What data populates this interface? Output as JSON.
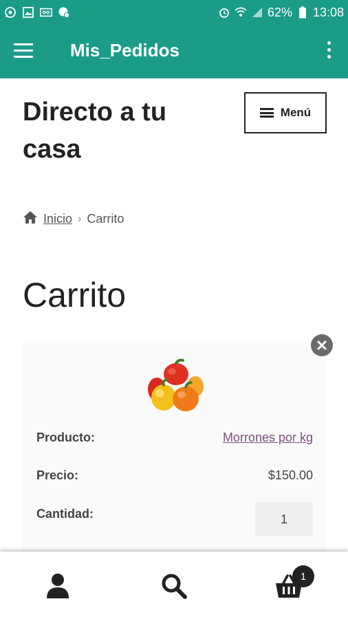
{
  "status_bar": {
    "battery": "62%",
    "time": "13:08",
    "icons": [
      "whatsapp-icon",
      "gallery-icon",
      "voicemail-icon",
      "messenger-icon",
      "alarm-icon",
      "wifi-icon",
      "signal-icon",
      "battery-icon"
    ]
  },
  "app_bar": {
    "title": "Mis_Pedidos",
    "color": "#1a9c87"
  },
  "header": {
    "site_title": "Directo a tu casa",
    "menu_label": "Menú"
  },
  "breadcrumb": {
    "home": "Inicio",
    "separator": "›",
    "current": "Carrito"
  },
  "page": {
    "title": "Carrito"
  },
  "cart": {
    "items": [
      {
        "image": "bell-peppers",
        "product_label": "Producto:",
        "product_name": "Morrones por kg",
        "price_label": "Precio:",
        "price": "$150.00",
        "quantity_label": "Cantidad:",
        "quantity": "1"
      }
    ]
  },
  "bottom_nav": {
    "items": [
      "account-icon",
      "search-icon",
      "basket-icon"
    ],
    "cart_count": "1"
  }
}
